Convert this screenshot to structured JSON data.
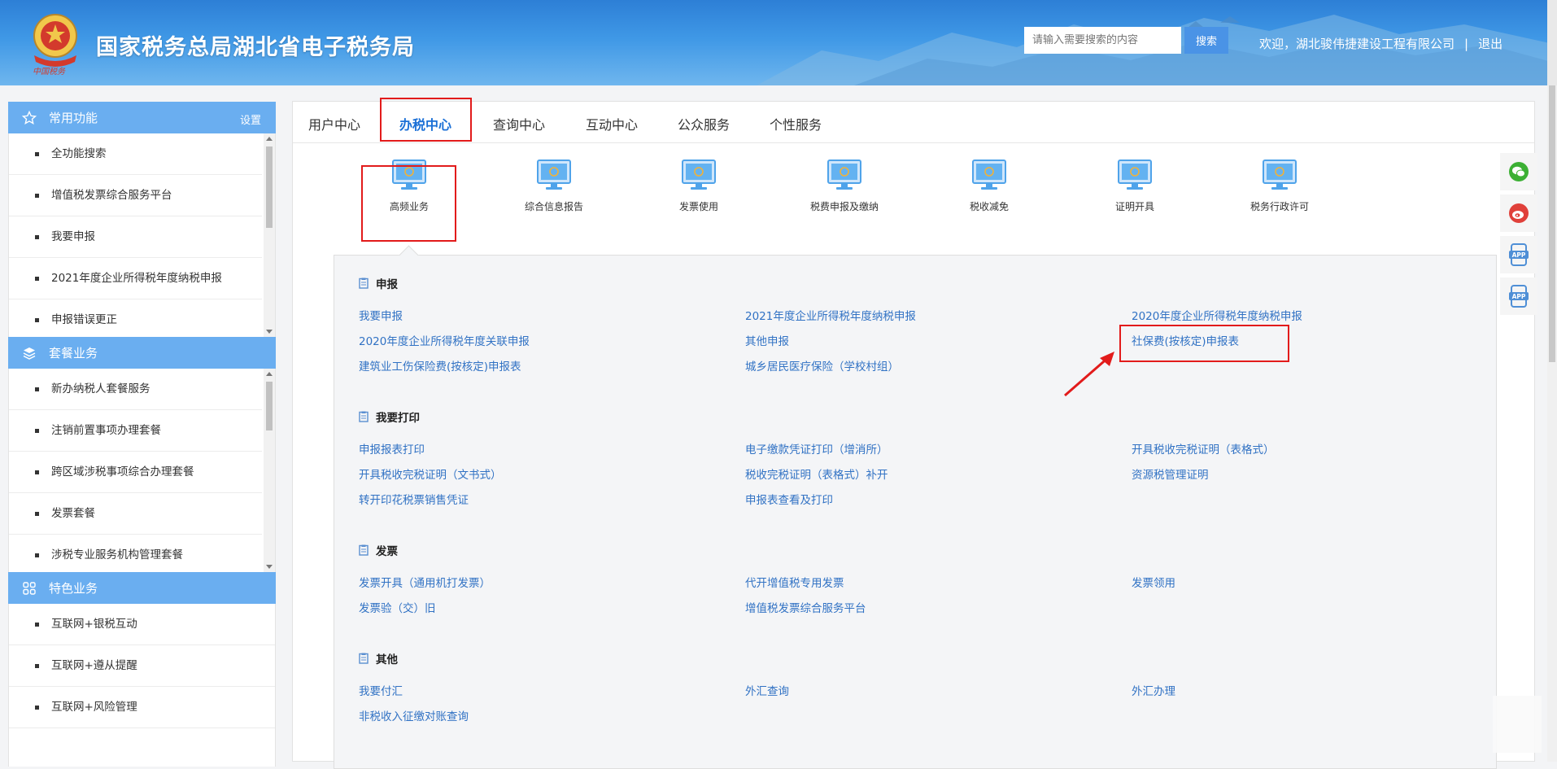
{
  "header": {
    "title": "国家税务总局湖北省电子税务局",
    "search_placeholder": "请输入需要搜索的内容",
    "search_button": "搜索",
    "welcome_text": "欢迎，湖北骏伟捷建设工程有限公司",
    "separator": "|",
    "logout": "退出",
    "emblem_script": "中国税务"
  },
  "sidebar": {
    "common": {
      "title": "常用功能",
      "setting": "设置",
      "icon": "star-icon",
      "items": [
        "全功能搜索",
        "增值税发票综合服务平台",
        "我要申报",
        "2021年度企业所得税年度纳税申报",
        "申报错误更正"
      ]
    },
    "package": {
      "title": "套餐业务",
      "icon": "layers-icon",
      "items": [
        "新办纳税人套餐服务",
        "注销前置事项办理套餐",
        "跨区域涉税事项综合办理套餐",
        "发票套餐",
        "涉税专业服务机构管理套餐"
      ]
    },
    "special": {
      "title": "特色业务",
      "icon": "grid-icon",
      "items": [
        "互联网+银税互动",
        "互联网+遵从提醒",
        "互联网+风险管理"
      ]
    }
  },
  "tabs": [
    "用户中心",
    "办税中心",
    "查询中心",
    "互动中心",
    "公众服务",
    "个性服务"
  ],
  "active_tab": "办税中心",
  "categories": [
    "高频业务",
    "综合信息报告",
    "发票使用",
    "税费申报及缴纳",
    "税收减免",
    "证明开具",
    "税务行政许可"
  ],
  "active_category": "高频业务",
  "sections": [
    {
      "title": "申报",
      "links": [
        "我要申报",
        "2021年度企业所得税年度纳税申报",
        "2020年度企业所得税年度纳税申报",
        "2020年度企业所得税年度关联申报",
        "其他申报",
        "社保费(按核定)申报表",
        "建筑业工伤保险费(按核定)申报表",
        "城乡居民医疗保险（学校村组）"
      ]
    },
    {
      "title": "我要打印",
      "links": [
        "申报报表打印",
        "电子缴款凭证打印（增消所）",
        "开具税收完税证明（表格式）",
        "开具税收完税证明（文书式）",
        "税收完税证明（表格式）补开",
        "资源税管理证明",
        "转开印花税票销售凭证",
        "申报表查看及打印"
      ]
    },
    {
      "title": "发票",
      "links": [
        "发票开具（通用机打发票）",
        "代开增值税专用发票",
        "发票领用",
        "发票验（交）旧",
        "增值税发票综合服务平台"
      ]
    },
    {
      "title": "其他",
      "links": [
        "我要付汇",
        "外汇查询",
        "外汇办理",
        "非税收入征缴对账查询"
      ]
    }
  ],
  "highlighted_link": "社保费(按核定)申报表",
  "float_icons": [
    "wechat-icon",
    "weibo-icon",
    "app-icon",
    "app-icon"
  ],
  "float_labels": [
    "APP",
    "APP"
  ],
  "colors": {
    "header_blue": "#2d7fd6",
    "sidebar_head": "#6aaef0",
    "link_blue": "#3172c4",
    "highlight_red": "#e21b1b"
  }
}
